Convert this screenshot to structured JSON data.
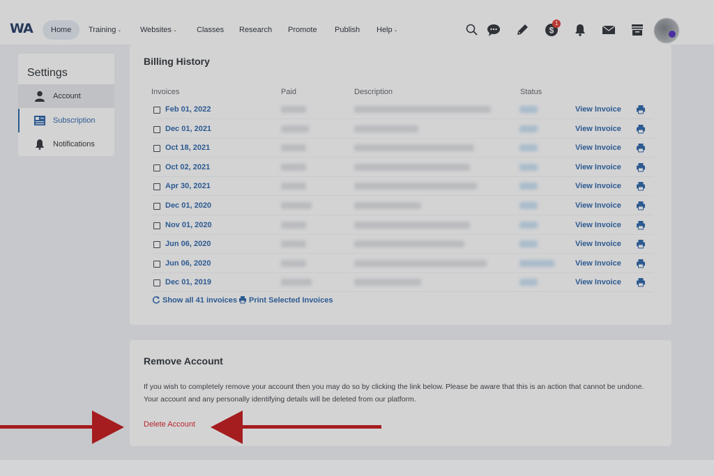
{
  "brand": {
    "logo_text": "WA"
  },
  "nav": {
    "items": [
      {
        "label": "Home",
        "dropdown": false
      },
      {
        "label": "Training",
        "dropdown": true
      },
      {
        "label": "Websites",
        "dropdown": true
      },
      {
        "label": "Classes",
        "dropdown": false
      },
      {
        "label": "Research",
        "dropdown": false
      },
      {
        "label": "Promote",
        "dropdown": false
      },
      {
        "label": "Publish",
        "dropdown": false
      },
      {
        "label": "Help",
        "dropdown": true
      }
    ],
    "chevron": "⌄",
    "icons": [
      "search-icon",
      "chat-icon",
      "pencil-icon",
      "dollar-icon",
      "bell-icon",
      "mail-icon",
      "archive-icon"
    ],
    "dollar_badge": "1"
  },
  "sidebar": {
    "title": "Settings",
    "items": [
      {
        "label": "Account",
        "icon": "user-icon"
      },
      {
        "label": "Subscription",
        "icon": "card-icon"
      },
      {
        "label": "Notifications",
        "icon": "bell-icon"
      }
    ]
  },
  "billing": {
    "title": "Billing History",
    "columns": {
      "invoices": "Invoices",
      "paid": "Paid",
      "description": "Description",
      "status": "Status"
    },
    "rows": [
      {
        "date": "Feb 01, 2022",
        "action": "View Invoice"
      },
      {
        "date": "Dec 01, 2021",
        "action": "View Invoice"
      },
      {
        "date": "Oct 18, 2021",
        "action": "View Invoice"
      },
      {
        "date": "Oct 02, 2021",
        "action": "View Invoice"
      },
      {
        "date": "Apr 30, 2021",
        "action": "View Invoice"
      },
      {
        "date": "Dec 01, 2020",
        "action": "View Invoice"
      },
      {
        "date": "Nov 01, 2020",
        "action": "View Invoice"
      },
      {
        "date": "Jun 06, 2020",
        "action": "View Invoice"
      },
      {
        "date": "Jun 06, 2020",
        "action": "View Invoice"
      },
      {
        "date": "Dec 01, 2019",
        "action": "View Invoice"
      }
    ],
    "show_all": "Show all 41 invoices",
    "print_selected": "Print Selected Invoices"
  },
  "remove": {
    "title": "Remove Account",
    "text_line1": "If you wish to completely remove your account then you may do so by clicking the link below. Please be aware that this is an action that cannot be undone.",
    "text_line2": "Your account and any personally identifying details will be deleted from our platform.",
    "delete_label": "Delete Account"
  },
  "colors": {
    "link": "#2d5a90",
    "danger": "#b8262c",
    "arrow": "#a51d1f",
    "panel": "#d3d3d4",
    "backdrop": "#c6c8cb"
  }
}
